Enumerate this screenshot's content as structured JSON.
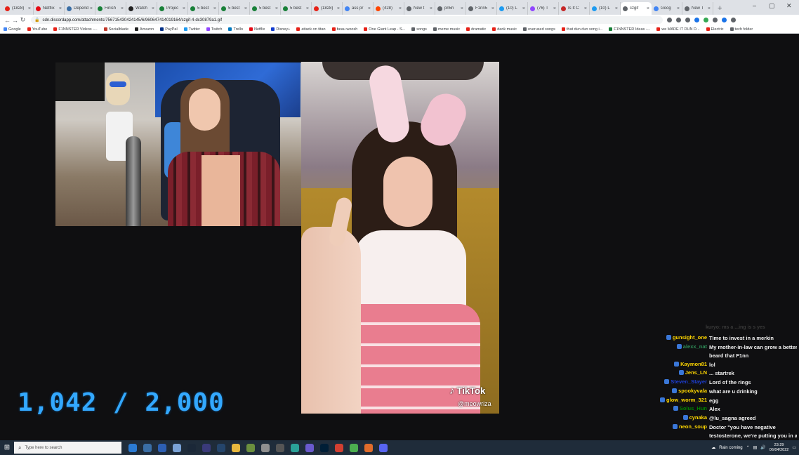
{
  "browser": {
    "tabs": [
      {
        "label": "(1828)",
        "color": "#e62117"
      },
      {
        "label": "Netflix",
        "color": "#e50914"
      },
      {
        "label": "Dependa",
        "color": "#3a6ea5"
      },
      {
        "label": "Finish",
        "color": "#188038"
      },
      {
        "label": "Watch",
        "color": "#222222"
      },
      {
        "label": "Projec",
        "color": "#188038"
      },
      {
        "label": "5 best",
        "color": "#188038"
      },
      {
        "label": "5 best",
        "color": "#188038"
      },
      {
        "label": "5 best",
        "color": "#188038"
      },
      {
        "label": "5 best",
        "color": "#188038"
      },
      {
        "label": "(1828)",
        "color": "#e62117"
      },
      {
        "label": "ass pr",
        "color": "#4285f4"
      },
      {
        "label": "(428)",
        "color": "#ff4500"
      },
      {
        "label": "New t",
        "color": "#5f6368"
      },
      {
        "label": "pn5h",
        "color": "#5f6368"
      },
      {
        "label": "F1nn5",
        "color": "#5f6368"
      },
      {
        "label": "(10) L",
        "color": "#1d9bf0"
      },
      {
        "label": "(76) T",
        "color": "#9146ff"
      },
      {
        "label": "Is It C",
        "color": "#c62828"
      },
      {
        "label": "(10) L",
        "color": "#1d9bf0"
      },
      {
        "label": "czgif",
        "color": "#5f6368"
      },
      {
        "label": "Goog",
        "color": "#4285f4"
      },
      {
        "label": "New T",
        "color": "#5f6368"
      }
    ],
    "active_tab_index": 20,
    "new_tab_label": "+",
    "url": "cdn.discordapp.com/attachments/756715430424145/6/960647414019164/czgif-4-dc30879a1.gif",
    "bookmarks": [
      {
        "label": "Google",
        "color": "#4285f4"
      },
      {
        "label": "YouTube",
        "color": "#e62117"
      },
      {
        "label": "F1NNSTER Videos -...",
        "color": "#e62117"
      },
      {
        "label": "Socialblade",
        "color": "#c0392b"
      },
      {
        "label": "Amazon",
        "color": "#222222"
      },
      {
        "label": "PayPal",
        "color": "#003087"
      },
      {
        "label": "Twitter",
        "color": "#1d9bf0"
      },
      {
        "label": "Twitch",
        "color": "#9146ff"
      },
      {
        "label": "Trello",
        "color": "#0079bf"
      },
      {
        "label": "Netflix",
        "color": "#e50914"
      },
      {
        "label": "Disney+",
        "color": "#113ccf"
      },
      {
        "label": "attack on titan",
        "color": "#e62117"
      },
      {
        "label": "beau woosh",
        "color": "#e62117"
      },
      {
        "label": "One Giant Leap - S...",
        "color": "#e62117"
      },
      {
        "label": "songs",
        "color": "#5f6368"
      },
      {
        "label": "meme music",
        "color": "#5f6368"
      },
      {
        "label": "dramatic",
        "color": "#e62117"
      },
      {
        "label": "dank music",
        "color": "#e62117"
      },
      {
        "label": "overused songs",
        "color": "#5f6368"
      },
      {
        "label": "that dun dun song i...",
        "color": "#e62117"
      },
      {
        "label": "F1NNSTER Ideas -...",
        "color": "#188038"
      },
      {
        "label": "we MADE IT DUN D...",
        "color": "#e62117"
      },
      {
        "label": "Electric",
        "color": "#e62117"
      },
      {
        "label": "tech folder",
        "color": "#5f6368"
      }
    ]
  },
  "overlay": {
    "counter": "1,042 / 2,000",
    "tiktok_logo": "TikTok",
    "tiktok_handle": "@meowriza"
  },
  "chat": {
    "faded_line": "kuryo: ms a ...ing is s yes",
    "messages": [
      {
        "user": "gunsight_one",
        "color": "#ffd700",
        "text": "Time to invest in a merkin"
      },
      {
        "user": "alexx_nat",
        "color": "#2e8b57",
        "text": "My mother-in-law can grow a better beard that F1nn"
      },
      {
        "user": "Kaymon81",
        "color": "#ffd700",
        "text": "lol"
      },
      {
        "user": "Jens_LN",
        "color": "#ffd700",
        "text": "... startrek"
      },
      {
        "user": "Steven_Stayer",
        "color": "#1e3fd6",
        "text": "Lord of the rings"
      },
      {
        "user": "spookyvala",
        "color": "#ffd700",
        "text": "what are u drinking"
      },
      {
        "user": "glow_worm_321",
        "color": "#ffd700",
        "text": "egg"
      },
      {
        "user": "Solus_Hun",
        "color": "#008000",
        "text": "Alex"
      },
      {
        "user": "cynaka",
        "color": "#ffd700",
        "text": "@lu_sagna agreed"
      },
      {
        "user": "neon_soup",
        "color": "#ffd700",
        "text": "Doctor \"you have negative testosterone, we're putting you in a study\""
      }
    ]
  },
  "taskbar": {
    "search_placeholder": "Type here to search",
    "weather": "Rain coming",
    "time": "23:29",
    "date": "06/04/2022",
    "icons": [
      {
        "name": "edge-icon",
        "color": "#2b7bd4"
      },
      {
        "name": "app-icon-2",
        "color": "#3a6ea5"
      },
      {
        "name": "app-icon-3",
        "color": "#2d5fb3"
      },
      {
        "name": "app-icon-4",
        "color": "#7aa2d6"
      },
      {
        "name": "steam-icon",
        "color": "#1b2838"
      },
      {
        "name": "app-icon-6",
        "color": "#3a3a7a"
      },
      {
        "name": "vegas-icon",
        "color": "#25456b"
      },
      {
        "name": "file-explorer-icon",
        "color": "#e8b83e"
      },
      {
        "name": "minecraft-icon",
        "color": "#6b8f3e"
      },
      {
        "name": "app-icon-10",
        "color": "#8f8f8f"
      },
      {
        "name": "app-icon-11",
        "color": "#555555"
      },
      {
        "name": "app-icon-12",
        "color": "#2aa198"
      },
      {
        "name": "app-icon-13",
        "color": "#6a5acd"
      },
      {
        "name": "photoshop-icon",
        "color": "#001e36"
      },
      {
        "name": "app-icon-15",
        "color": "#d23f31"
      },
      {
        "name": "chrome-icon",
        "color": "#4caf50"
      },
      {
        "name": "app-icon-17",
        "color": "#e06c2b"
      },
      {
        "name": "discord-icon",
        "color": "#5865f2"
      }
    ]
  }
}
